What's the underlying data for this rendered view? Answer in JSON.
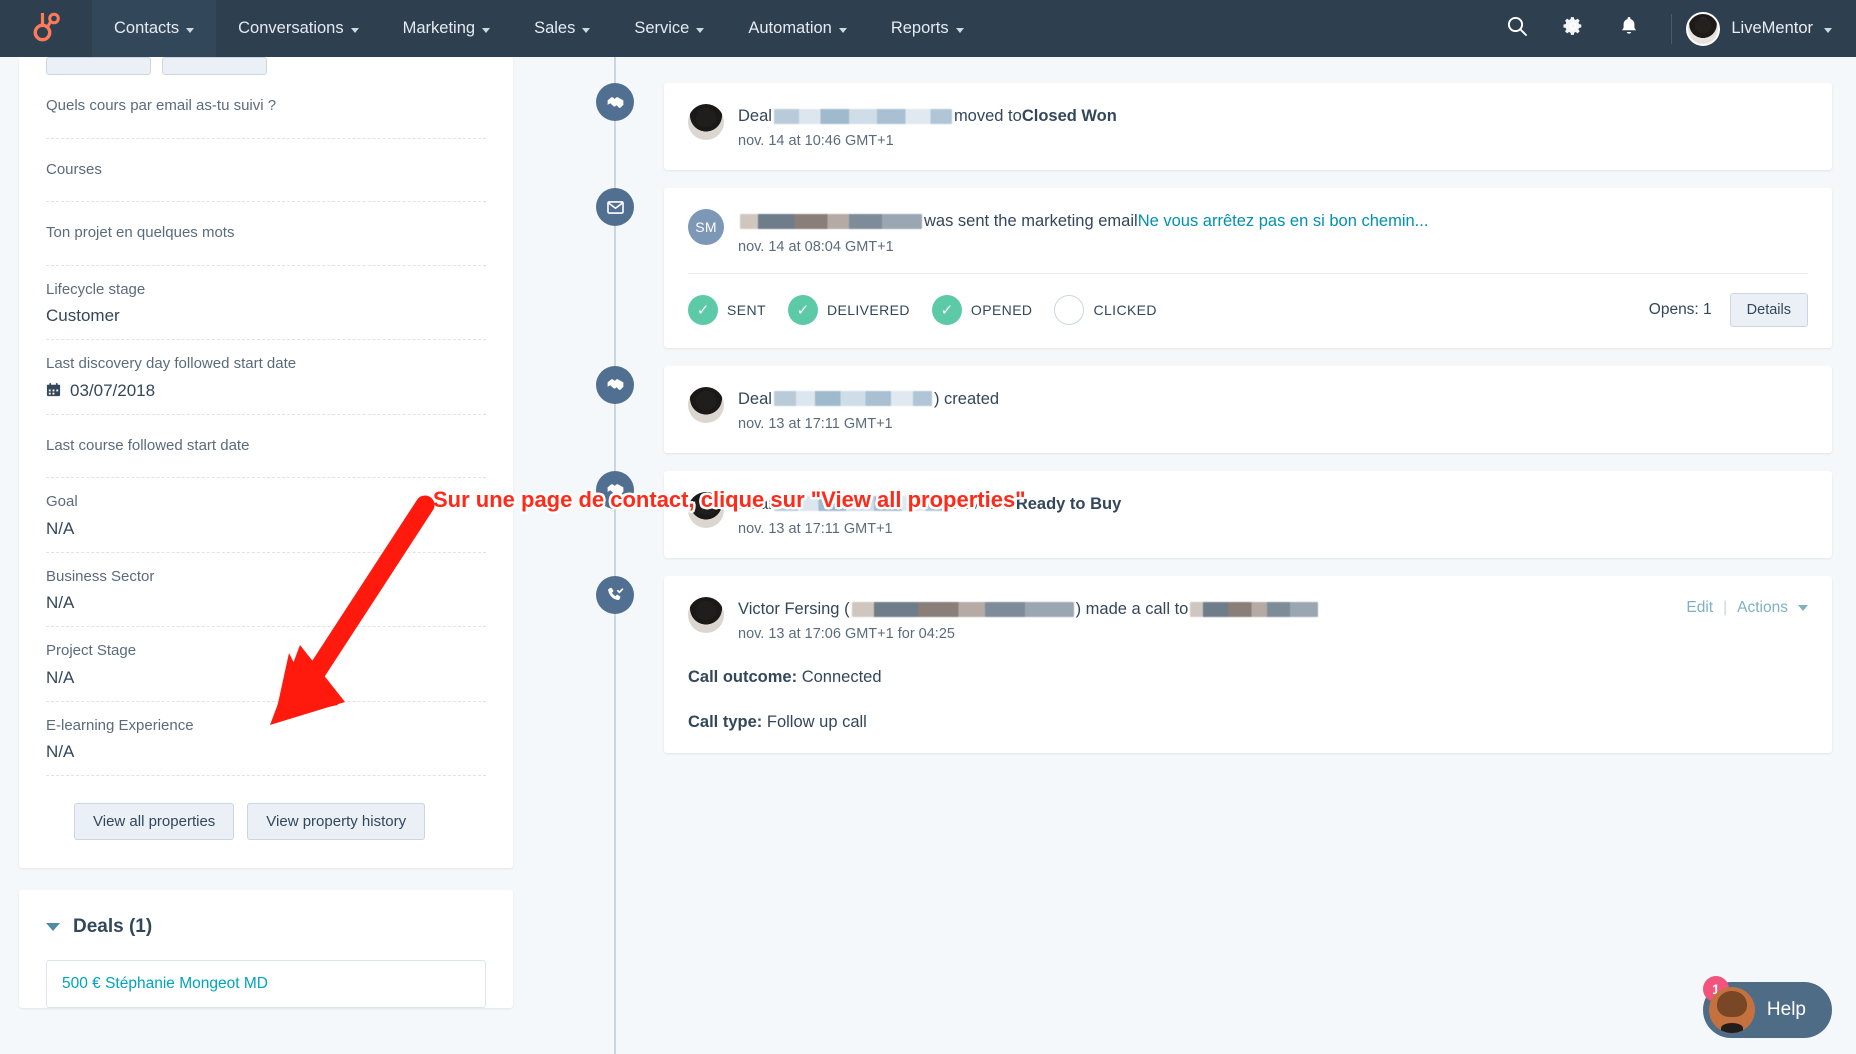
{
  "nav": {
    "logo_icon": "hubspot-sprocket-logo",
    "items": [
      {
        "label": "Contacts",
        "active": true
      },
      {
        "label": "Conversations",
        "active": false
      },
      {
        "label": "Marketing",
        "active": false
      },
      {
        "label": "Sales",
        "active": false
      },
      {
        "label": "Service",
        "active": false
      },
      {
        "label": "Automation",
        "active": false
      },
      {
        "label": "Reports",
        "active": false
      }
    ],
    "search_icon": "search-icon",
    "settings_icon": "gear-icon",
    "notifications_icon": "bell-icon",
    "account_name": "LiveMentor"
  },
  "sidebar": {
    "properties": [
      {
        "label": "Quels cours par email as-tu suivi ?",
        "value": ""
      },
      {
        "label": "Courses",
        "value": ""
      },
      {
        "label": "Ton projet en quelques mots",
        "value": ""
      },
      {
        "label": "Lifecycle stage",
        "value": "Customer"
      },
      {
        "label": "Last discovery day followed start date",
        "value": "03/07/2018",
        "icon": "calendar-icon"
      },
      {
        "label": "Last course followed start date",
        "value": ""
      },
      {
        "label": "Goal",
        "value": "N/A"
      },
      {
        "label": "Business Sector",
        "value": "N/A"
      },
      {
        "label": "Project Stage",
        "value": "N/A"
      },
      {
        "label": "E-learning Experience",
        "value": "N/A"
      }
    ],
    "view_all_properties": "View all properties",
    "view_property_history": "View property history",
    "deals_title": "Deals (1)",
    "deal_item": "500 € Stéphanie Mongeot MD"
  },
  "timeline": {
    "events": [
      {
        "kind": "deal",
        "badge_icon": "handshake-icon",
        "avatar": "photo",
        "prefix": "Deal",
        "redacted": true,
        "suffix": " moved to ",
        "bold_tail": "Closed Won",
        "time": "nov. 14 at 10:46 GMT+1"
      },
      {
        "kind": "email",
        "badge_icon": "envelope-icon",
        "avatar": "initials",
        "initials": "SM",
        "prefix": "",
        "redacted": true,
        "suffix": " was sent the marketing email ",
        "link_tail": "Ne vous arrêtez pas en si bon chemin...",
        "time": "nov. 14 at 08:04 GMT+1",
        "statuses": [
          {
            "label": "SENT",
            "done": true
          },
          {
            "label": "DELIVERED",
            "done": true
          },
          {
            "label": "OPENED",
            "done": true
          },
          {
            "label": "CLICKED",
            "done": false
          }
        ],
        "opens": "Opens: 1",
        "details_label": "Details"
      },
      {
        "kind": "deal",
        "badge_icon": "handshake-icon",
        "avatar": "photo",
        "prefix": "Deal ",
        "redacted": true,
        "suffix": ") created",
        "bold_tail": "",
        "time": "nov. 13 at 17:11 GMT+1"
      },
      {
        "kind": "deal",
        "badge_icon": "handshake-icon",
        "avatar": "photo",
        "prefix": "Deal ",
        "redacted": true,
        "suffix": " moved to ",
        "bold_tail": "Ready to Buy",
        "time": "nov. 13 at 17:11 GMT+1"
      },
      {
        "kind": "call",
        "badge_icon": "phone-check-icon",
        "avatar": "photo",
        "prefix": "Victor Fersing (",
        "redacted": true,
        "suffix": ") made a call to ",
        "time": "nov. 13 at 17:06 GMT+1 for 04:25",
        "edit_label": "Edit",
        "actions_label": "Actions",
        "call_outcome_label": "Call outcome:",
        "call_outcome_value": "Connected",
        "call_type_label": "Call type:",
        "call_type_value": "Follow up call"
      }
    ]
  },
  "annotation": {
    "text": "Sur une page de contact, clique sur \"View all properties\"",
    "color": "#ff2a1a",
    "arrow_color": "#ff1a0d"
  },
  "help": {
    "label": "Help",
    "badge": "1"
  }
}
